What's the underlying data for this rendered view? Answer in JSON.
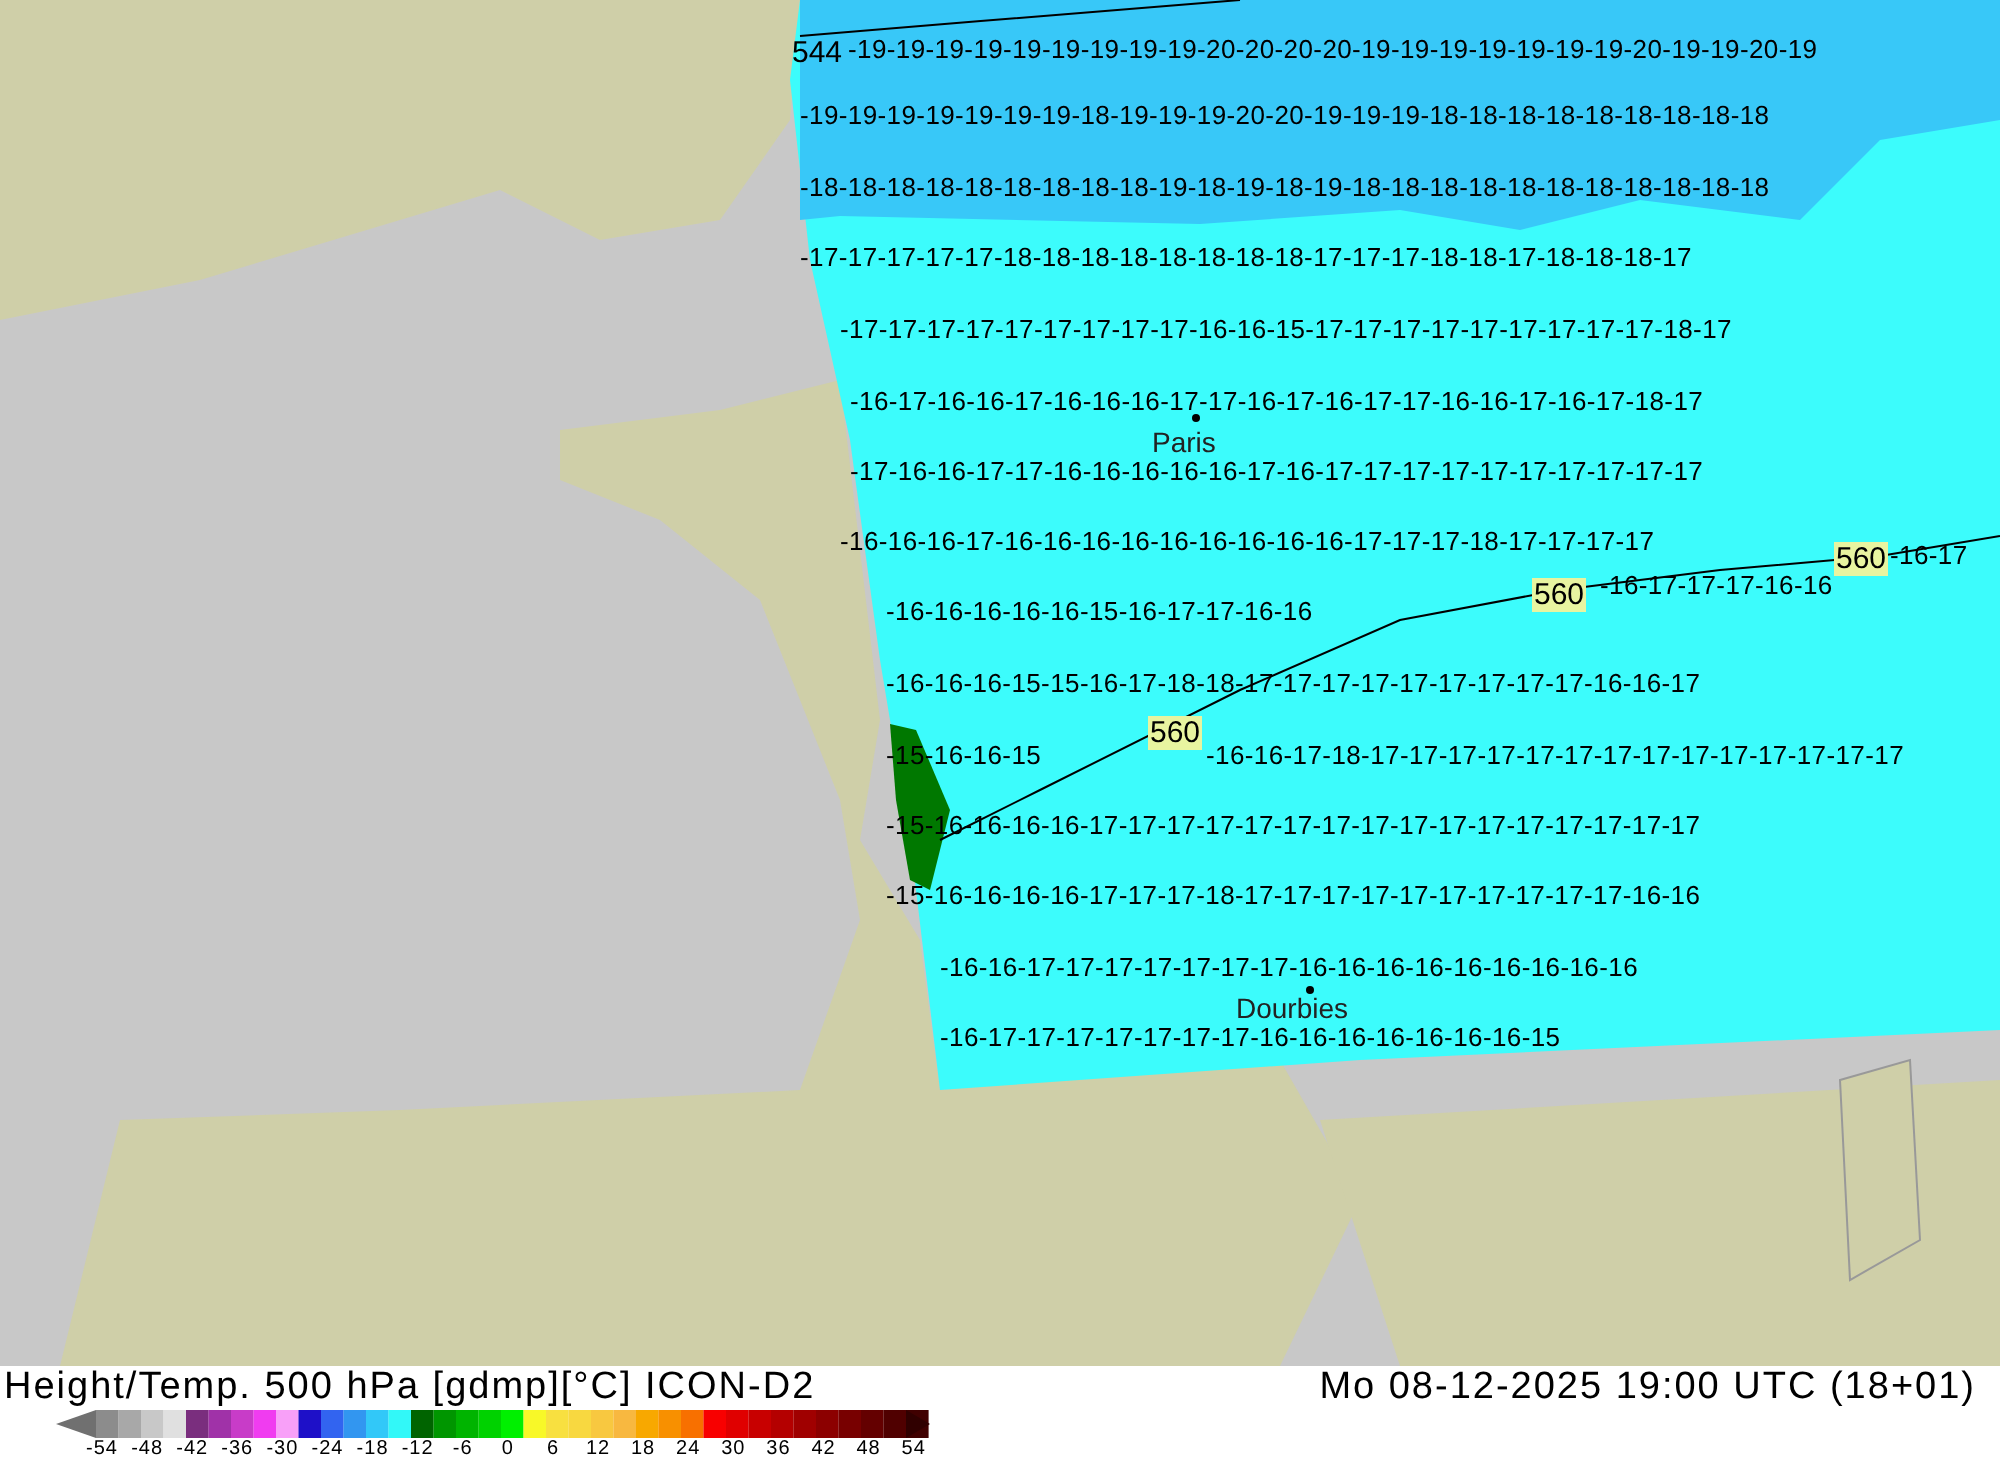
{
  "title": "Height/Temp. 500 hPa [gdmp][°C] ICON-D2",
  "valid_time": "Mo 08-12-2025 19:00 UTC (18+01)",
  "map": {
    "contour_labels": [
      "544",
      "560",
      "560",
      "560"
    ],
    "cities": [
      {
        "name": "Paris"
      },
      {
        "name": "Dourbies"
      }
    ],
    "temperature_rows": [
      "-19-19-19-19-19-19-19-19-19-20-20-20-20-19-19-19-19-19-19-19-20-19-19-20-19",
      "-19-19-19-19-19-19-19-18-19-19-19-20-20-19-19-19-18-18-18-18-18-18-18-18-18",
      "-18-18-18-18-18-18-18-18-18-19-18-19-18-19-18-18-18-18-18-18-18-18-18-18-18",
      "-17-17-17-17-17-18-18-18-18-18-18-18-18-17-17-17-18-18-17-18-18-18-17",
      "-17-17-17-17-17-17-17-17-17-16-16-15-17-17-17-17-17-17-17-17-17-18-17",
      "-16-17-16-16-17-16-16-16-17-17-16-17-16-17-17-16-16-17-16-17-18-17",
      "-17-16-16-17-17-16-16-16-16-16-17-16-17-17-17-17-17-17-17-17-17-17",
      "-16-16-16-17-16-16-16-16-16-16-16-16-16-17-17-17-18-17-17-17-17",
      "-16-16-16-16-16-15-16-17-17-16-16",
      "-16-17-17-17-16-16",
      "-16-17",
      "-16-16-16-15-15-16-17-18-18-17-17-17-17-17-17-17-17-17-16-16-17",
      "-15-16-16-15",
      "-16-16-17-18-17-17-17-17-17-17-17-17-17-17-17-17-17-17",
      "-15-16-16-16-16-17-17-17-17-17-17-17-17-17-17-17-17-17-17-17-17",
      "-15-16-16-16-16-17-17-17-18-17-17-17-17-17-17-17-17-17-17-16-16",
      "-16-16-17-17-17-17-17-17-17-16-16-16-16-16-16-16-16-16",
      "-16-17-17-17-17-17-17-17-16-16-16-16-16-16-16-15"
    ]
  },
  "legend": {
    "ticks": [
      "-54",
      "-48",
      "-42",
      "-36",
      "-30",
      "-24",
      "-18",
      "-12",
      "-6",
      "0",
      "6",
      "12",
      "18",
      "24",
      "30",
      "36",
      "42",
      "48",
      "54"
    ]
  }
}
